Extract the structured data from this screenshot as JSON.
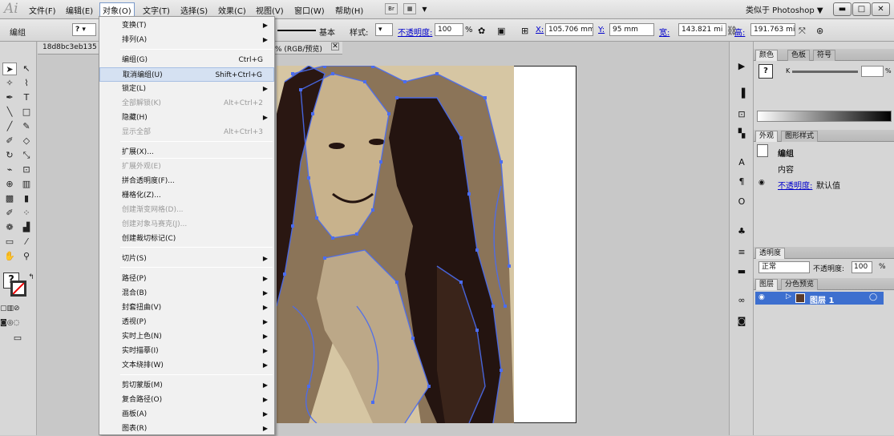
{
  "menubar": {
    "items": [
      "文件(F)",
      "编辑(E)",
      "对象(O)",
      "文字(T)",
      "选择(S)",
      "效果(C)",
      "视图(V)",
      "窗口(W)",
      "帮助(H)"
    ],
    "workspace": "类似于 Photoshop ▼",
    "tool_br": "Br"
  },
  "control": {
    "group": "编组",
    "stroke_basic": "基本",
    "style_label": "样式:",
    "opacity_label": "不透明度:",
    "opacity_value": "100",
    "opacity_unit": "%",
    "x_label": "X:",
    "x_value": "105.706 mm",
    "y_label": "Y:",
    "y_value": "95 mm",
    "w_label": "宽:",
    "w_value": "143.821 mi",
    "h_label": "高:",
    "h_value": "191.763 mi"
  },
  "document": {
    "tab_title": "18d8bc3eb135",
    "tab_suffix": "% (RGB/预览)"
  },
  "object_menu": {
    "items": [
      {
        "label": "变换(T)",
        "shortcut": "",
        "submenu": true,
        "disabled": false
      },
      {
        "label": "排列(A)",
        "shortcut": "",
        "submenu": true,
        "disabled": false
      },
      {
        "label": "编组(G)",
        "shortcut": "Ctrl+G",
        "submenu": false,
        "disabled": false
      },
      {
        "label": "取消编组(U)",
        "shortcut": "Shift+Ctrl+G",
        "submenu": false,
        "disabled": false,
        "highlighted": true
      },
      {
        "label": "锁定(L)",
        "shortcut": "",
        "submenu": true,
        "disabled": false
      },
      {
        "label": "全部解锁(K)",
        "shortcut": "Alt+Ctrl+2",
        "submenu": false,
        "disabled": true
      },
      {
        "label": "隐藏(H)",
        "shortcut": "",
        "submenu": true,
        "disabled": false
      },
      {
        "label": "显示全部",
        "shortcut": "Alt+Ctrl+3",
        "submenu": false,
        "disabled": true
      },
      {
        "label": "扩展(X)...",
        "shortcut": "",
        "submenu": false,
        "disabled": false
      },
      {
        "label": "扩展外观(E)",
        "shortcut": "",
        "submenu": false,
        "disabled": true
      },
      {
        "label": "拼合透明度(F)...",
        "shortcut": "",
        "submenu": false,
        "disabled": false
      },
      {
        "label": "栅格化(Z)...",
        "shortcut": "",
        "submenu": false,
        "disabled": false
      },
      {
        "label": "创建渐变网格(D)...",
        "shortcut": "",
        "submenu": false,
        "disabled": true
      },
      {
        "label": "创建对象马赛克(J)...",
        "shortcut": "",
        "submenu": false,
        "disabled": true
      },
      {
        "label": "创建裁切标记(C)",
        "shortcut": "",
        "submenu": false,
        "disabled": false
      },
      {
        "label": "切片(S)",
        "shortcut": "",
        "submenu": true,
        "disabled": false
      },
      {
        "label": "路径(P)",
        "shortcut": "",
        "submenu": true,
        "disabled": false
      },
      {
        "label": "混合(B)",
        "shortcut": "",
        "submenu": true,
        "disabled": false
      },
      {
        "label": "封套扭曲(V)",
        "shortcut": "",
        "submenu": true,
        "disabled": false
      },
      {
        "label": "透视(P)",
        "shortcut": "",
        "submenu": true,
        "disabled": false
      },
      {
        "label": "实时上色(N)",
        "shortcut": "",
        "submenu": true,
        "disabled": false
      },
      {
        "label": "实时描摹(I)",
        "shortcut": "",
        "submenu": true,
        "disabled": false
      },
      {
        "label": "文本绕排(W)",
        "shortcut": "",
        "submenu": true,
        "disabled": false
      },
      {
        "label": "剪切蒙版(M)",
        "shortcut": "",
        "submenu": true,
        "disabled": false
      },
      {
        "label": "复合路径(O)",
        "shortcut": "",
        "submenu": true,
        "disabled": false
      },
      {
        "label": "画板(A)",
        "shortcut": "",
        "submenu": true,
        "disabled": false
      },
      {
        "label": "图表(R)",
        "shortcut": "",
        "submenu": true,
        "disabled": false
      }
    ]
  },
  "panels": {
    "color_tabs": [
      "颜色",
      "色板",
      "符号"
    ],
    "color_k_label": "K",
    "color_pct": "%",
    "appearance_tabs": [
      "外观",
      "图形样式"
    ],
    "appearance_group": "编组",
    "appearance_content": "内容",
    "appearance_opacity_label": "不透明度:",
    "appearance_opacity_value": "默认值",
    "transparency_tab": "透明度",
    "blend_mode": "正常",
    "transparency_opacity_label": "不透明度:",
    "transparency_opacity_value": "100",
    "transparency_pct": "%",
    "layers_tabs": [
      "图层",
      "分色预览"
    ],
    "layer_name": "图层 1"
  }
}
